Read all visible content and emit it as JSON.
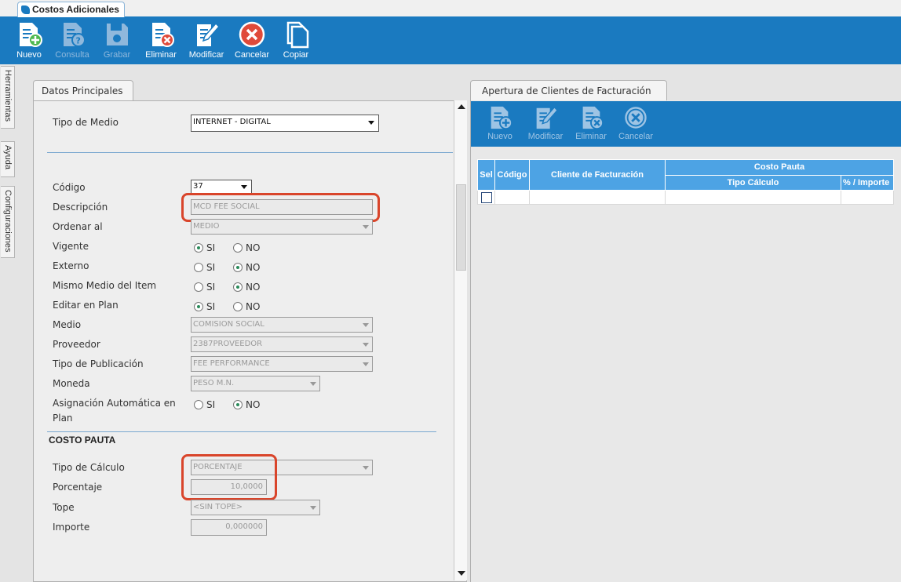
{
  "app_tab": {
    "title": "Costos Adicionales"
  },
  "toolbar": [
    {
      "label": "Nuevo",
      "icon": "new-doc-icon",
      "enabled": true
    },
    {
      "label": "Consulta",
      "icon": "query-doc-icon",
      "enabled": false
    },
    {
      "label": "Grabar",
      "icon": "save-icon",
      "enabled": false
    },
    {
      "label": "Eliminar",
      "icon": "delete-doc-icon",
      "enabled": true
    },
    {
      "label": "Modificar",
      "icon": "edit-doc-icon",
      "enabled": true
    },
    {
      "label": "Cancelar",
      "icon": "cancel-icon",
      "enabled": true
    },
    {
      "label": "Copiar",
      "icon": "copy-icon",
      "enabled": true
    }
  ],
  "side_tabs": [
    "Herramientas",
    "Ayuda",
    "Configuraciones"
  ],
  "left": {
    "tab": "Datos Principales",
    "tipo_medio": {
      "label": "Tipo de Medio",
      "value": "INTERNET - DIGITAL"
    },
    "codigo": {
      "label": "Código",
      "value": "37"
    },
    "descripcion": {
      "label": "Descripción",
      "value": "MCD FEE SOCIAL"
    },
    "ordenar": {
      "label": "Ordenar al",
      "value": "MEDIO"
    },
    "vigente": {
      "label": "Vigente",
      "value": "SI"
    },
    "externo": {
      "label": "Externo",
      "value": "NO"
    },
    "mismo_medio": {
      "label": "Mismo Medio del Item",
      "value": "NO"
    },
    "editar_plan": {
      "label": "Editar en Plan",
      "value": "SI"
    },
    "medio": {
      "label": "Medio",
      "value": "COMISION SOCIAL"
    },
    "proveedor": {
      "label": "Proveedor",
      "value": "2387PROVEEDOR"
    },
    "tipo_publicacion": {
      "label": "Tipo de Publicación",
      "value": "FEE PERFORMANCE"
    },
    "moneda": {
      "label": "Moneda",
      "value": "PESO M.N."
    },
    "asignacion": {
      "label_1": "Asignación Automática en",
      "label_2": "Plan",
      "value": "NO"
    },
    "radio_si": "SI",
    "radio_no": "NO",
    "costo_pauta": {
      "header": "COSTO PAUTA",
      "tipo_calculo": {
        "label": "Tipo de Cálculo",
        "value": "PORCENTAJE"
      },
      "porcentaje": {
        "label": "Porcentaje",
        "value": "10,0000"
      },
      "tope": {
        "label": "Tope",
        "value": "<SIN TOPE>"
      },
      "importe": {
        "label": "Importe",
        "value": "0,000000"
      }
    }
  },
  "right": {
    "tab": "Apertura de Clientes de Facturación",
    "toolbar": [
      {
        "label": "Nuevo",
        "icon": "new-doc-icon"
      },
      {
        "label": "Modificar",
        "icon": "edit-doc-icon"
      },
      {
        "label": "Eliminar",
        "icon": "delete-doc-icon"
      },
      {
        "label": "Cancelar",
        "icon": "cancel-icon"
      }
    ],
    "grid": {
      "col_sel": "Sel",
      "col_codigo": "Código",
      "col_cliente": "Cliente de Facturación",
      "group_costo": "Costo Pauta",
      "col_tipo": "Tipo Cálculo",
      "col_importe": "% / Importe"
    }
  },
  "colors": {
    "accent": "#1a7ac0",
    "grid_header": "#4da3e4",
    "highlight": "#d9452b",
    "radio_on": "#2a8a5a"
  }
}
